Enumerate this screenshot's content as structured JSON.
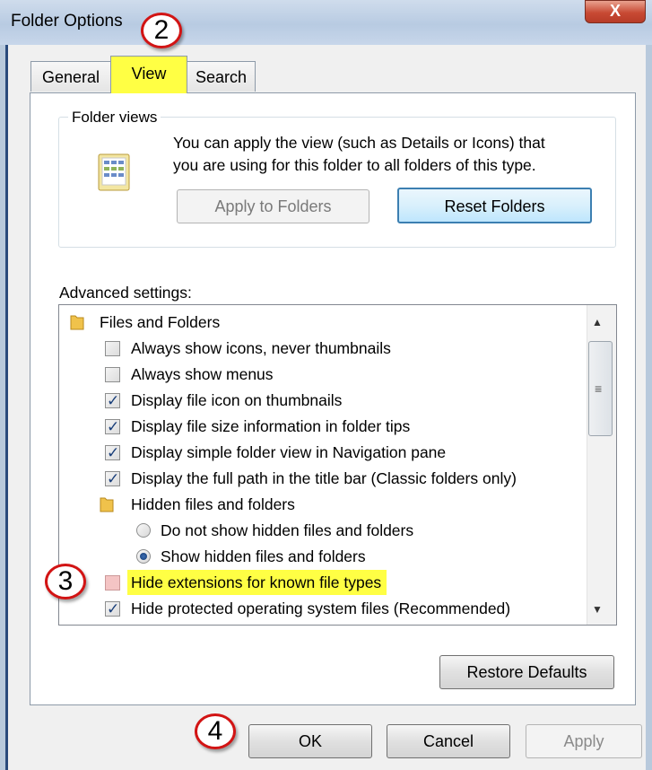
{
  "window": {
    "title": "Folder Options",
    "close_glyph": "X"
  },
  "tabs": [
    {
      "label": "General"
    },
    {
      "label": "View"
    },
    {
      "label": "Search"
    }
  ],
  "folder_views": {
    "group_label": "Folder views",
    "description_line1": "You can apply the view (such as Details or Icons) that",
    "description_line2": "you are using for this folder to all folders of this type.",
    "apply_button": "Apply to Folders",
    "reset_button": "Reset Folders"
  },
  "advanced": {
    "label": "Advanced settings:",
    "items": [
      {
        "type": "folder",
        "label": "Files and Folders"
      },
      {
        "type": "checkbox",
        "checked": false,
        "label": "Always show icons, never thumbnails"
      },
      {
        "type": "checkbox",
        "checked": false,
        "label": "Always show menus"
      },
      {
        "type": "checkbox",
        "checked": true,
        "label": "Display file icon on thumbnails"
      },
      {
        "type": "checkbox",
        "checked": true,
        "label": "Display file size information in folder tips"
      },
      {
        "type": "checkbox",
        "checked": true,
        "label": "Display simple folder view in Navigation pane"
      },
      {
        "type": "checkbox",
        "checked": true,
        "label": "Display the full path in the title bar (Classic folders only)"
      },
      {
        "type": "folder",
        "label": "Hidden files and folders"
      },
      {
        "type": "radio",
        "checked": false,
        "label": "Do not show hidden files and folders"
      },
      {
        "type": "radio",
        "checked": true,
        "label": "Show hidden files and folders"
      },
      {
        "type": "checkbox",
        "checked": false,
        "label": "Hide extensions for known file types"
      },
      {
        "type": "checkbox",
        "checked": true,
        "label": "Hide protected operating system files (Recommended)"
      }
    ],
    "restore_button": "Restore Defaults"
  },
  "buttons": {
    "ok": "OK",
    "cancel": "Cancel",
    "apply": "Apply"
  },
  "callouts": {
    "step2": "2",
    "step3": "3",
    "step4": "4"
  },
  "colors": {
    "highlight": "#ffff44",
    "callout_border": "#d21414",
    "focus_button_border": "#3c7fb1"
  },
  "icons": [
    "folder-view-icon",
    "folder-icon",
    "close-icon",
    "scroll-up-icon",
    "scroll-down-icon"
  ]
}
